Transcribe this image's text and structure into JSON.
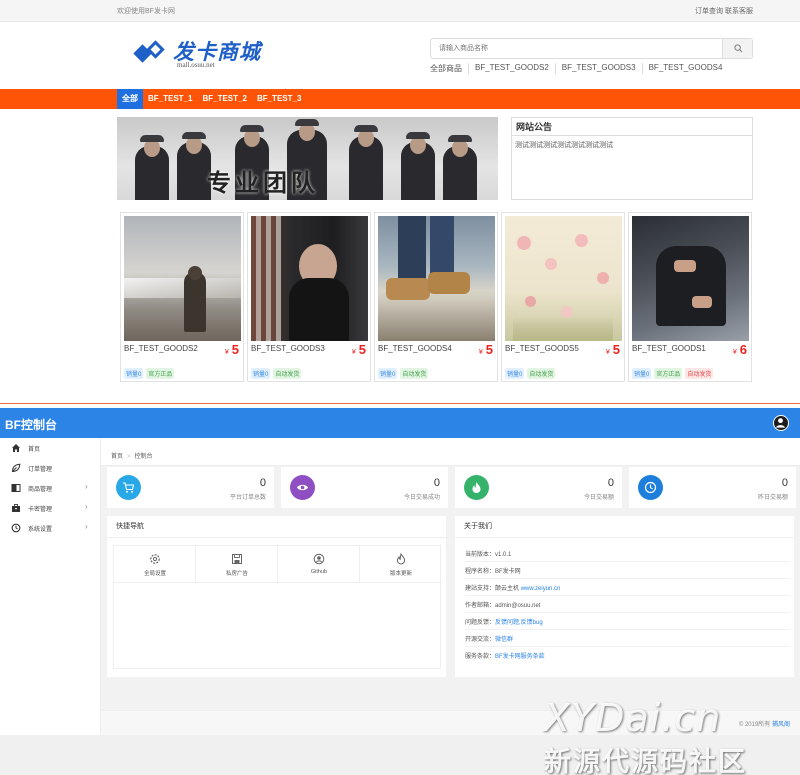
{
  "topbar": {
    "welcome": "欢迎使用BF发卡网",
    "links": "订单查询 联系客服"
  },
  "logo": {
    "title": "发卡商城",
    "subtitle": "mall.osuu.net"
  },
  "search": {
    "placeholder": "请输入商品名称"
  },
  "quicklinks": [
    "全部商品",
    "BF_TEST_GOODS2",
    "BF_TEST_GOODS3",
    "BF_TEST_GOODS4"
  ],
  "nav": [
    "全部",
    "BF_TEST_1",
    "BF_TEST_2",
    "BF_TEST_3"
  ],
  "banner": {
    "slogan": "专业团队"
  },
  "notice": {
    "title": "网站公告",
    "body": "测试测试测试测试测试测试测试"
  },
  "currency": "¥",
  "goods": [
    {
      "name": "BF_TEST_GOODS2",
      "price": "5",
      "tags": [
        "销量0",
        "官方正品"
      ]
    },
    {
      "name": "BF_TEST_GOODS3",
      "price": "5",
      "tags": [
        "销量0",
        "自动发货"
      ]
    },
    {
      "name": "BF_TEST_GOODS4",
      "price": "5",
      "tags": [
        "销量0",
        "自动发货"
      ]
    },
    {
      "name": "BF_TEST_GOODS5",
      "price": "5",
      "tags": [
        "销量0",
        "自动发货"
      ]
    },
    {
      "name": "BF_TEST_GOODS1",
      "price": "6",
      "tags": [
        "销量0",
        "官方正品",
        "自动发货"
      ]
    }
  ],
  "admin": {
    "brand": "BF控制台",
    "menu": [
      "首页",
      "订单管理",
      "商品管理",
      "卡密管理",
      "系统设置"
    ],
    "breadcrumb": [
      "首页",
      "控制台"
    ],
    "stats": [
      {
        "value": "0",
        "caption": "平台订单总数",
        "color": "#29a8e8"
      },
      {
        "value": "0",
        "caption": "今日交易成功",
        "color": "#8e4fc2"
      },
      {
        "value": "0",
        "caption": "今日交易额",
        "color": "#35b36b"
      },
      {
        "value": "0",
        "caption": "昨日交易额",
        "color": "#1d7fdb"
      }
    ],
    "quicknav": {
      "title": "快捷导航",
      "items": [
        "全局设置",
        "私房广告",
        "Github",
        "版本更新"
      ]
    },
    "about": {
      "title": "关于我们",
      "rows": [
        {
          "label": "当前版本：",
          "value": "v1.0.1"
        },
        {
          "label": "程序名称：",
          "value": "BF发卡网"
        },
        {
          "label": "建站支持：",
          "value": "颠云主机",
          "link": "www.zeiyun.cn"
        },
        {
          "label": "作者邮箱：",
          "value": "admin@osuu.net"
        },
        {
          "label": "问题反馈：",
          "link": "反馈问题,反馈bug"
        },
        {
          "label": "开源交流：",
          "link": "微信群"
        },
        {
          "label": "服务条款：",
          "link": "BF发卡网服务条款"
        }
      ]
    },
    "footer": {
      "copy": "© 2019所有",
      "author": "捕风阁"
    }
  },
  "watermark": {
    "line1": "XYDai.cn",
    "line2": "新源代源码社区"
  }
}
